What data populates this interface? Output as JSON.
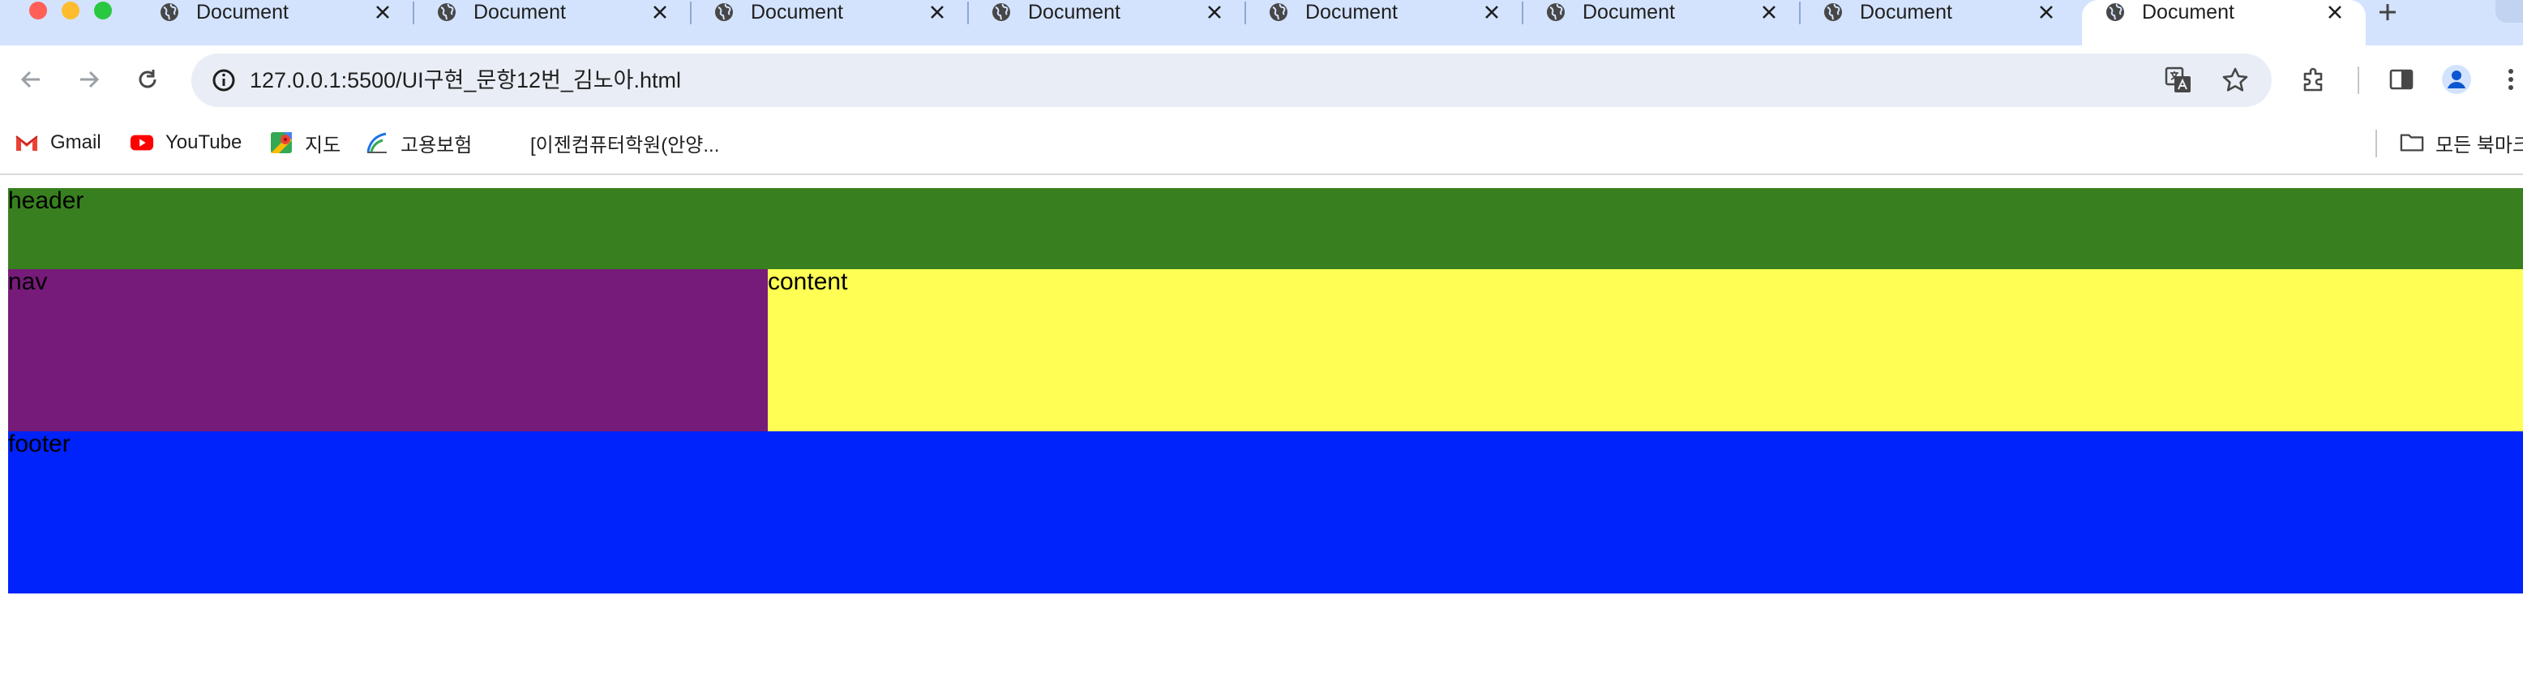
{
  "browser": {
    "tabs": [
      {
        "title": "Document",
        "active": false
      },
      {
        "title": "Document",
        "active": false
      },
      {
        "title": "Document",
        "active": false
      },
      {
        "title": "Document",
        "active": false
      },
      {
        "title": "Document",
        "active": false
      },
      {
        "title": "Document",
        "active": false
      },
      {
        "title": "Document",
        "active": false
      },
      {
        "title": "Document",
        "active": true
      }
    ],
    "url": "127.0.0.1:5500/UI구현_문항12번_김노아.html",
    "bookmarks": [
      {
        "label": "Gmail",
        "icon": "gmail-icon"
      },
      {
        "label": "YouTube",
        "icon": "youtube-icon"
      },
      {
        "label": "지도",
        "icon": "maps-icon"
      },
      {
        "label": "고용보험",
        "icon": "employment-insurance-icon"
      },
      {
        "label": "[이젠컴퓨터학원(안양...",
        "icon": ""
      },
      {
        "label": "모든 북마크",
        "icon": "folder-icon"
      }
    ]
  },
  "page": {
    "header": {
      "label": "header",
      "color": "#38801f"
    },
    "nav": {
      "label": "nav",
      "color": "#761b7a"
    },
    "content": {
      "label": "content",
      "color": "#fefe54"
    },
    "footer": {
      "label": "footer",
      "color": "#0022fb"
    }
  }
}
